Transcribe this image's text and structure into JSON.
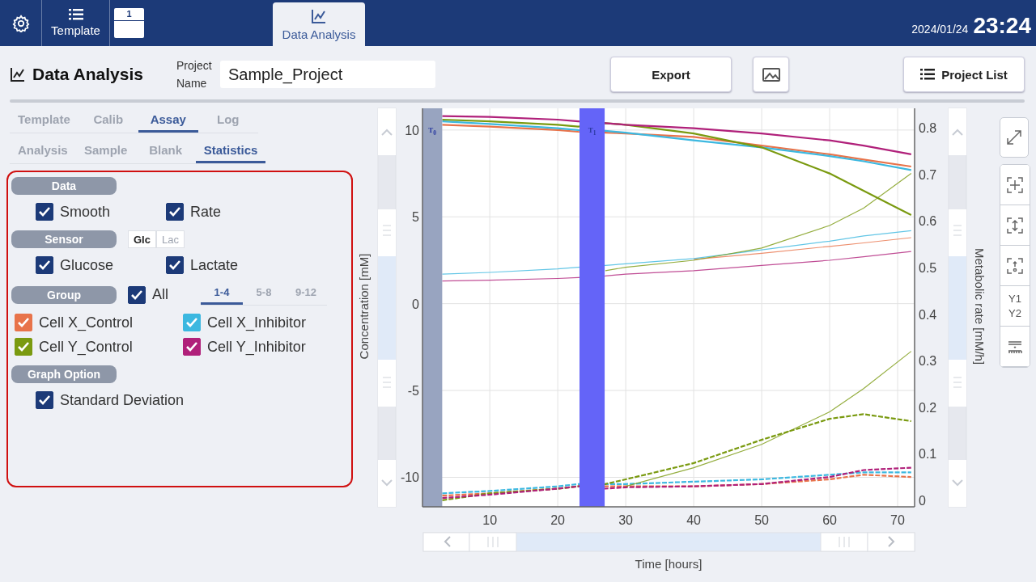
{
  "nav": {
    "items": [
      {
        "kind": "settings"
      },
      {
        "kind": "tab",
        "label": "Template",
        "selected": false
      },
      {
        "kind": "page",
        "label": "1"
      },
      {
        "kind": "tab",
        "label": "Data Analysis",
        "selected": true
      }
    ],
    "date": "2024/01/24",
    "time": "23:24"
  },
  "header": {
    "title": "Data Analysis",
    "project_label": "Project Name",
    "project_name": "Sample_Project",
    "buttons": [
      {
        "kind": "text",
        "label": "Export"
      },
      {
        "kind": "image"
      },
      {
        "kind": "list",
        "label": "Project List"
      }
    ]
  },
  "tabs": [
    [
      {
        "label": "Template",
        "selected": false
      },
      {
        "label": "Calib",
        "selected": false
      },
      {
        "label": "Assay",
        "selected": true
      },
      {
        "label": "Log",
        "selected": false
      }
    ],
    [
      {
        "label": "Analysis",
        "selected": false
      },
      {
        "label": "Sample",
        "selected": false
      },
      {
        "label": "Blank",
        "selected": false
      },
      {
        "label": "Statistics",
        "selected": true
      }
    ]
  ],
  "sections": [
    {
      "label": "Data",
      "checks": [
        {
          "label": "Smooth",
          "checked": true
        },
        {
          "label": "Rate",
          "checked": true
        }
      ]
    },
    {
      "label": "Sensor",
      "toggle": [
        {
          "label": "Glc",
          "selected": true
        },
        {
          "label": "Lac",
          "selected": false
        }
      ],
      "checks": [
        {
          "label": "Glucose",
          "checked": true
        },
        {
          "label": "Lactate",
          "checked": true
        }
      ]
    },
    {
      "label": "Group",
      "all": {
        "label": "All",
        "checked": true
      },
      "pages": [
        {
          "label": "1-4",
          "selected": true
        },
        {
          "label": "5-8",
          "selected": false
        },
        {
          "label": "9-12",
          "selected": false
        }
      ],
      "checks": [
        {
          "label": "Cell X_Control",
          "checked": true,
          "color": "#e8734a"
        },
        {
          "label": "Cell X_Inhibitor",
          "checked": true,
          "color": "#3cb8e0"
        },
        {
          "label": "Cell Y_Control",
          "checked": true,
          "color": "#7a9a10"
        },
        {
          "label": "Cell Y_Inhibitor",
          "checked": true,
          "color": "#b0207a"
        }
      ]
    },
    {
      "label": "Graph Option",
      "checks": [
        {
          "label": "Standard Deviation",
          "checked": true
        }
      ]
    }
  ],
  "chart": {
    "chart_data": {
      "type": "line",
      "xlabel": "Time [hours]",
      "ylabel": "Concentration [mM]",
      "y2label": "Metabolic rate [mM/h]",
      "xlim": [
        0.1,
        72.5
      ],
      "ylim": [
        -11.7,
        11.25
      ],
      "y2lim": [
        -0.014,
        0.842
      ],
      "xticks": [
        10,
        20,
        30,
        40,
        50,
        60,
        70
      ],
      "yticks": [
        -10,
        -5,
        0,
        5,
        10
      ],
      "y2ticks": [
        0,
        0.1,
        0.2,
        0.3,
        0.4,
        0.5,
        0.6,
        0.7,
        0.8
      ],
      "grid": true,
      "x": [
        3,
        10,
        20,
        23,
        27,
        30,
        40,
        50,
        60,
        65,
        72
      ],
      "series": [
        {
          "color": "#e8734a",
          "axis": "y",
          "values": [
            10.3,
            10.2,
            10.0,
            9.9,
            9.85,
            9.8,
            9.6,
            9.1,
            8.6,
            8.3,
            7.9
          ]
        },
        {
          "color": "#3cb8e0",
          "axis": "y",
          "values": [
            10.5,
            10.35,
            10.1,
            10.0,
            9.95,
            9.85,
            9.4,
            9.0,
            8.5,
            8.2,
            7.7
          ]
        },
        {
          "color": "#7a9a10",
          "axis": "y",
          "values": [
            10.6,
            10.5,
            10.3,
            10.2,
            10.4,
            10.3,
            9.8,
            9.0,
            7.5,
            6.5,
            5.1
          ]
        },
        {
          "color": "#b0207a",
          "axis": "y",
          "values": [
            10.8,
            10.75,
            10.6,
            10.5,
            10.4,
            10.3,
            10.1,
            9.8,
            9.4,
            9.1,
            8.6
          ]
        },
        {
          "color": "#e8734a",
          "axis": "y",
          "values": [
            null,
            null,
            null,
            null,
            null,
            null,
            2.55,
            2.9,
            3.3,
            3.5,
            3.8
          ]
        },
        {
          "color": "#3cb8e0",
          "axis": "y",
          "values": [
            1.7,
            1.8,
            2.0,
            2.1,
            2.2,
            2.3,
            2.6,
            3.1,
            3.6,
            3.9,
            4.2
          ]
        },
        {
          "color": "#7a9a10",
          "axis": "y",
          "values": [
            null,
            null,
            null,
            null,
            1.9,
            2.1,
            2.5,
            3.2,
            4.5,
            5.5,
            7.5
          ]
        },
        {
          "color": "#b0207a",
          "axis": "y",
          "values": [
            1.3,
            1.35,
            1.45,
            1.5,
            1.6,
            1.7,
            1.9,
            2.2,
            2.5,
            2.7,
            3.0
          ]
        },
        {
          "color": "#e8734a",
          "axis": "y2",
          "line_style": "dashed",
          "values": [
            0.01,
            0.015,
            0.025,
            0.03,
            0.03,
            0.03,
            0.03,
            0.035,
            0.045,
            0.055,
            0.05
          ]
        },
        {
          "color": "#3cb8e0",
          "axis": "y2",
          "line_style": "dashed",
          "values": [
            0.015,
            0.02,
            0.03,
            0.035,
            0.035,
            0.035,
            0.04,
            0.045,
            0.055,
            0.06,
            0.06
          ]
        },
        {
          "color": "#7a9a10",
          "axis": "y2",
          "line_style": "dashed",
          "values": [
            0.0,
            0.015,
            0.025,
            0.03,
            0.035,
            0.045,
            0.08,
            0.13,
            0.175,
            0.185,
            0.17
          ]
        },
        {
          "color": "#b0207a",
          "axis": "y2",
          "line_style": "dashed",
          "values": [
            0.005,
            0.012,
            0.025,
            0.03,
            0.025,
            0.028,
            0.03,
            0.035,
            0.05,
            0.065,
            0.07
          ]
        },
        {
          "color": "#7a9a10",
          "axis": "y2",
          "values": [
            null,
            null,
            null,
            null,
            null,
            0.03,
            0.07,
            0.12,
            0.19,
            0.24,
            0.32
          ]
        }
      ],
      "bands": [
        {
          "axis": "x",
          "from": 0.1,
          "to": 3,
          "label": "T$_{0}$",
          "color": "#98a4c0"
        },
        {
          "axis": "x",
          "from": 23.2,
          "to": 26.9,
          "label": "T$_{1}$",
          "color": "#6464f8"
        }
      ]
    }
  },
  "toolbar": [
    {
      "kind": "expand"
    },
    {
      "kind": "fit"
    },
    {
      "kind": "fit-vertical"
    },
    {
      "kind": "zero"
    },
    {
      "kind": "axes",
      "labels": [
        "Y1",
        "Y2"
      ]
    },
    {
      "kind": "threshold"
    }
  ]
}
